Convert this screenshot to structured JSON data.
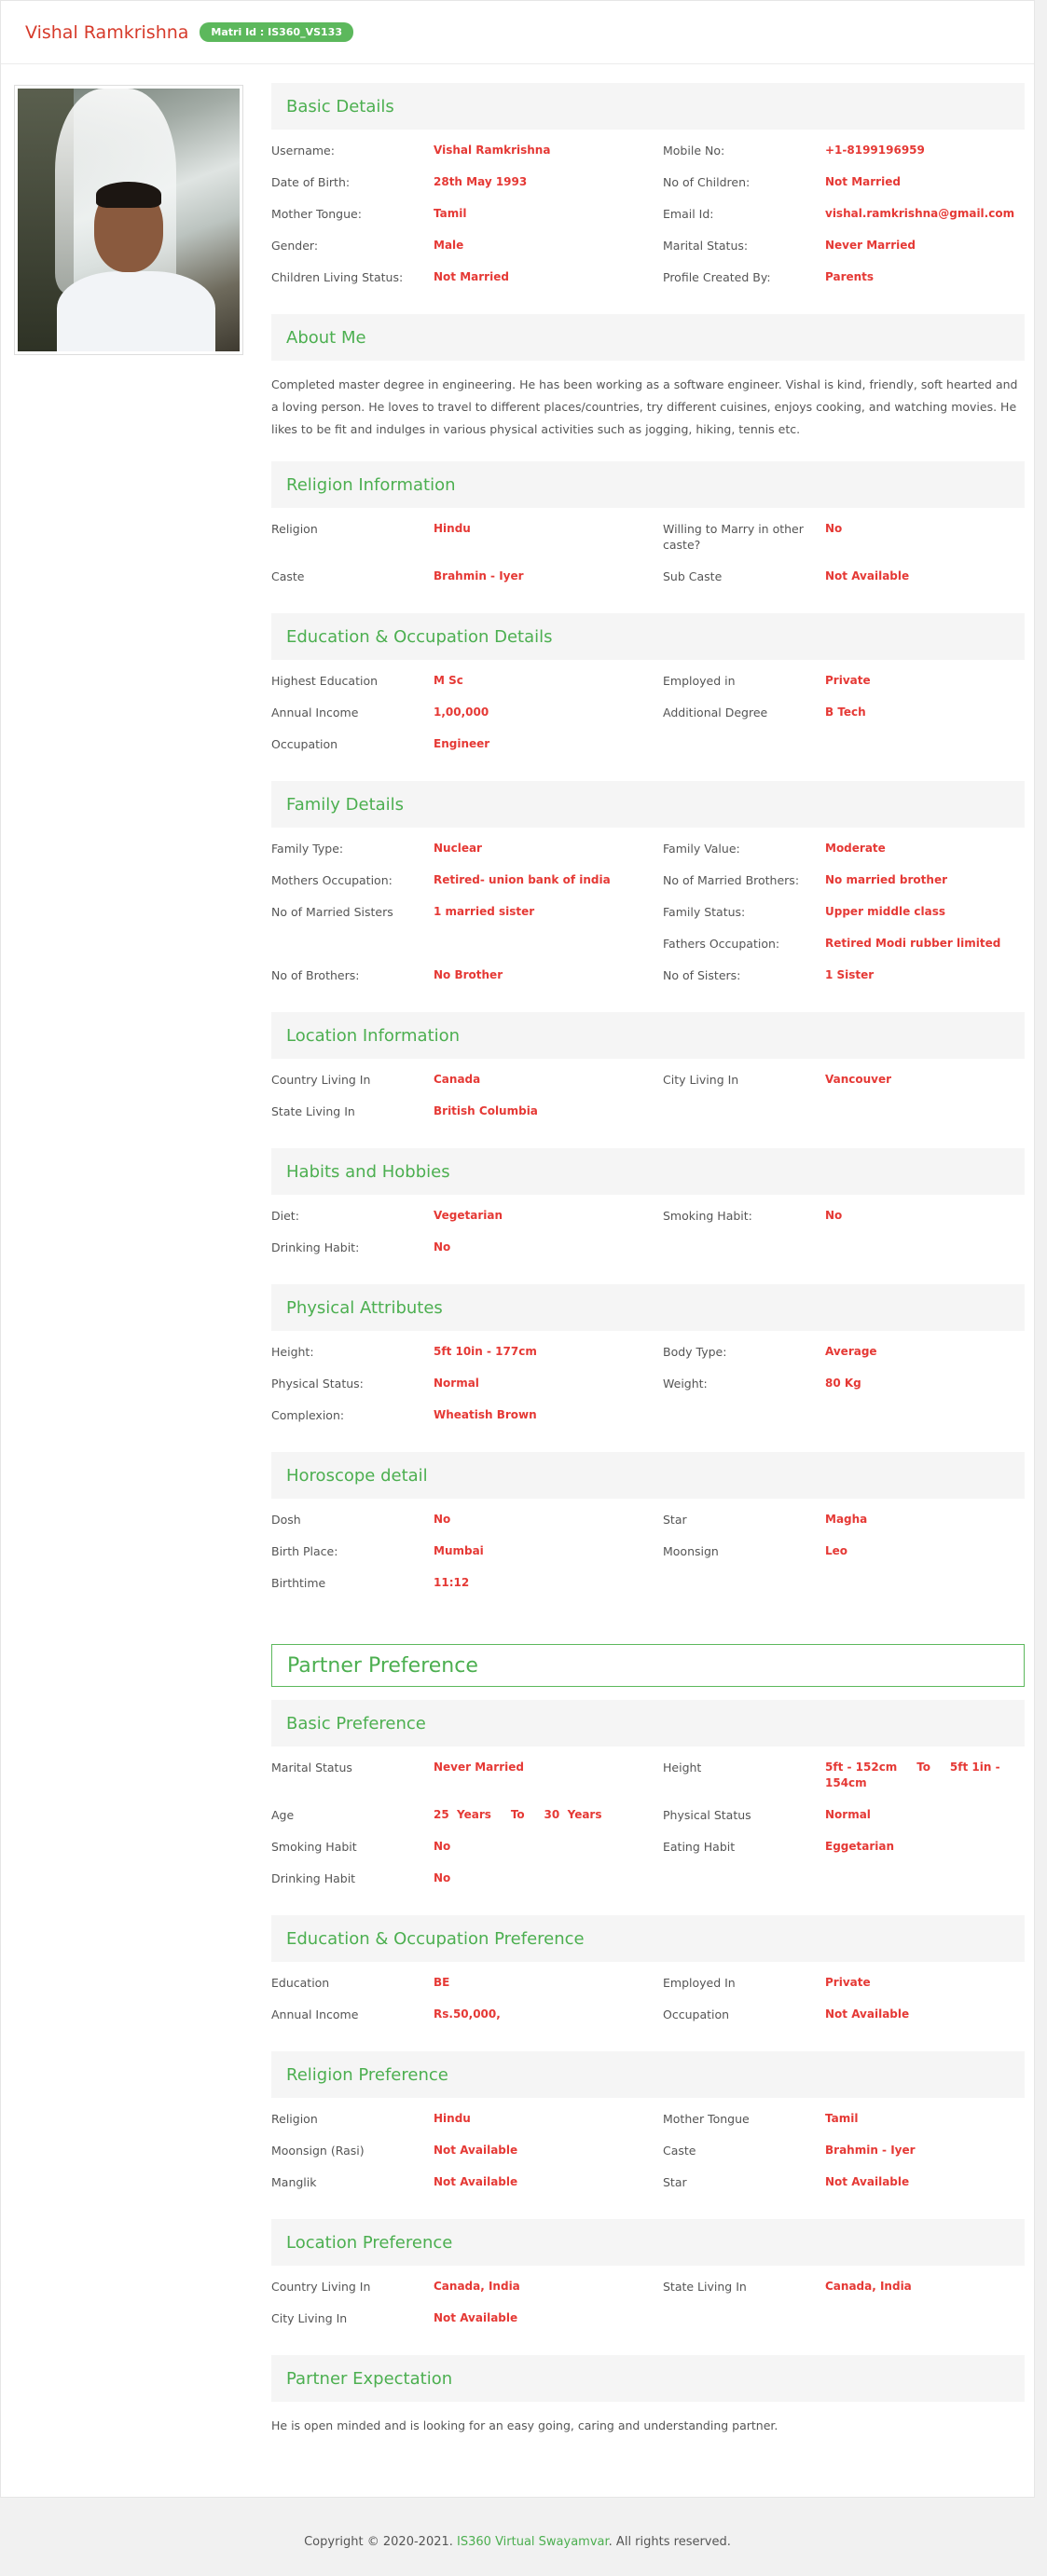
{
  "header": {
    "name": "Vishal Ramkrishna",
    "matri_id": "Matri Id : IS360_VS133"
  },
  "basic": {
    "title": "Basic Details",
    "rows": [
      [
        [
          "Username:",
          "Vishal Ramkrishna"
        ],
        [
          "Mobile No:",
          "+1-8199196959"
        ]
      ],
      [
        [
          "Date of Birth:",
          "28th May 1993"
        ],
        [
          "No of Children:",
          "Not Married"
        ]
      ],
      [
        [
          "Mother Tongue:",
          "Tamil"
        ],
        [
          "Email Id:",
          "vishal.ramkrishna@gmail.com"
        ]
      ],
      [
        [
          "Gender:",
          "Male"
        ],
        [
          "Marital Status:",
          "Never Married"
        ]
      ],
      [
        [
          "Children Living Status:",
          "Not Married"
        ],
        [
          "Profile Created By:",
          "Parents"
        ]
      ]
    ]
  },
  "about": {
    "title": "About Me",
    "text": "Completed master degree in engineering. He has been working as a software engineer. Vishal is kind, friendly, soft hearted and a loving person. He loves to travel to different places/countries, try different cuisines, enjoys cooking, and watching movies. He likes to be fit and indulges in various physical activities such as jogging, hiking, tennis etc."
  },
  "religion": {
    "title": "Religion Information",
    "rows": [
      [
        [
          "Religion",
          "Hindu"
        ],
        [
          "Willing to Marry in other caste?",
          "No"
        ]
      ],
      [
        [
          "Caste",
          "Brahmin - Iyer"
        ],
        [
          "Sub Caste",
          "Not Available"
        ]
      ]
    ]
  },
  "education": {
    "title": "Education & Occupation Details",
    "rows": [
      [
        [
          "Highest Education",
          "M Sc"
        ],
        [
          "Employed in",
          "Private"
        ]
      ],
      [
        [
          "Annual Income",
          "1,00,000"
        ],
        [
          "Additional Degree",
          "B Tech"
        ]
      ],
      [
        [
          "Occupation",
          "Engineer"
        ],
        [
          "",
          ""
        ]
      ]
    ]
  },
  "family": {
    "title": "Family Details",
    "rows": [
      [
        [
          "Family Type:",
          "Nuclear"
        ],
        [
          "Family Value:",
          "Moderate"
        ]
      ],
      [
        [
          "Mothers Occupation:",
          "Retired- union bank of india"
        ],
        [
          "No of Married Brothers:",
          "No married brother"
        ]
      ],
      [
        [
          "No of Married Sisters",
          "1 married sister"
        ],
        [
          "Family Status:",
          "Upper middle class"
        ]
      ],
      [
        [
          "",
          ""
        ],
        [
          "Fathers Occupation:",
          "Retired Modi rubber limited"
        ]
      ],
      [
        [
          "No of Brothers:",
          "No Brother"
        ],
        [
          "No of Sisters:",
          "1 Sister"
        ]
      ]
    ]
  },
  "location": {
    "title": "Location Information",
    "rows": [
      [
        [
          "Country Living In",
          "Canada"
        ],
        [
          "City Living In",
          "Vancouver"
        ]
      ],
      [
        [
          "State Living In",
          "British Columbia"
        ],
        [
          "",
          ""
        ]
      ]
    ]
  },
  "habits": {
    "title": "Habits and Hobbies",
    "rows": [
      [
        [
          "Diet:",
          "Vegetarian"
        ],
        [
          "Smoking Habit:",
          "No"
        ]
      ],
      [
        [
          "Drinking Habit:",
          "No"
        ],
        [
          "",
          ""
        ]
      ]
    ]
  },
  "physical": {
    "title": "Physical Attributes",
    "rows": [
      [
        [
          "Height:",
          "5ft 10in - 177cm"
        ],
        [
          "Body Type:",
          "Average"
        ]
      ],
      [
        [
          "Physical Status:",
          "Normal"
        ],
        [
          "Weight:",
          "80 Kg"
        ]
      ],
      [
        [
          "Complexion:",
          "Wheatish Brown"
        ],
        [
          "",
          ""
        ]
      ]
    ]
  },
  "horoscope": {
    "title": "Horoscope detail",
    "rows": [
      [
        [
          "Dosh",
          "No"
        ],
        [
          "Star",
          "Magha"
        ]
      ],
      [
        [
          "Birth Place:",
          "Mumbai"
        ],
        [
          "Moonsign",
          "Leo"
        ]
      ],
      [
        [
          "Birthtime",
          "11:12"
        ],
        [
          "",
          ""
        ]
      ]
    ]
  },
  "partner_title": "Partner Preference",
  "basic_pref": {
    "title": "Basic Preference",
    "rows": [
      [
        [
          "Marital Status",
          "Never Married"
        ],
        [
          "Height",
          "5ft - 152cm     To     5ft 1in - 154cm"
        ]
      ],
      [
        [
          "Age",
          "25  Years     To     30  Years"
        ],
        [
          "Physical Status",
          "Normal"
        ]
      ],
      [
        [
          "Smoking Habit",
          "No"
        ],
        [
          "Eating Habit",
          "Eggetarian"
        ]
      ],
      [
        [
          "Drinking Habit",
          "No"
        ],
        [
          "",
          ""
        ]
      ]
    ]
  },
  "edu_pref": {
    "title": "Education & Occupation Preference",
    "rows": [
      [
        [
          "Education",
          "BE"
        ],
        [
          "Employed In",
          "Private"
        ]
      ],
      [
        [
          "Annual Income",
          "Rs.50,000,"
        ],
        [
          "Occupation",
          "Not Available"
        ]
      ]
    ]
  },
  "religion_pref": {
    "title": "Religion Preference",
    "rows": [
      [
        [
          "Religion",
          "Hindu"
        ],
        [
          "Mother Tongue",
          "Tamil"
        ]
      ],
      [
        [
          "Moonsign (Rasi)",
          "Not Available"
        ],
        [
          "Caste",
          "Brahmin - Iyer"
        ]
      ],
      [
        [
          "Manglik",
          "Not Available"
        ],
        [
          "Star",
          "Not Available"
        ]
      ]
    ]
  },
  "location_pref": {
    "title": "Location Preference",
    "rows": [
      [
        [
          "Country Living In",
          "Canada, India"
        ],
        [
          "State Living In",
          "Canada, India"
        ]
      ],
      [
        [
          "City Living In",
          "Not Available"
        ],
        [
          "",
          ""
        ]
      ]
    ]
  },
  "expectation": {
    "title": "Partner Expectation",
    "text": "He is open minded and is looking for an easy going, caring and understanding partner."
  },
  "footer": {
    "prefix": "Copyright © 2020-2021.",
    "brand": "IS360 Virtual Swayamvar",
    "suffix": ". All rights reserved."
  }
}
